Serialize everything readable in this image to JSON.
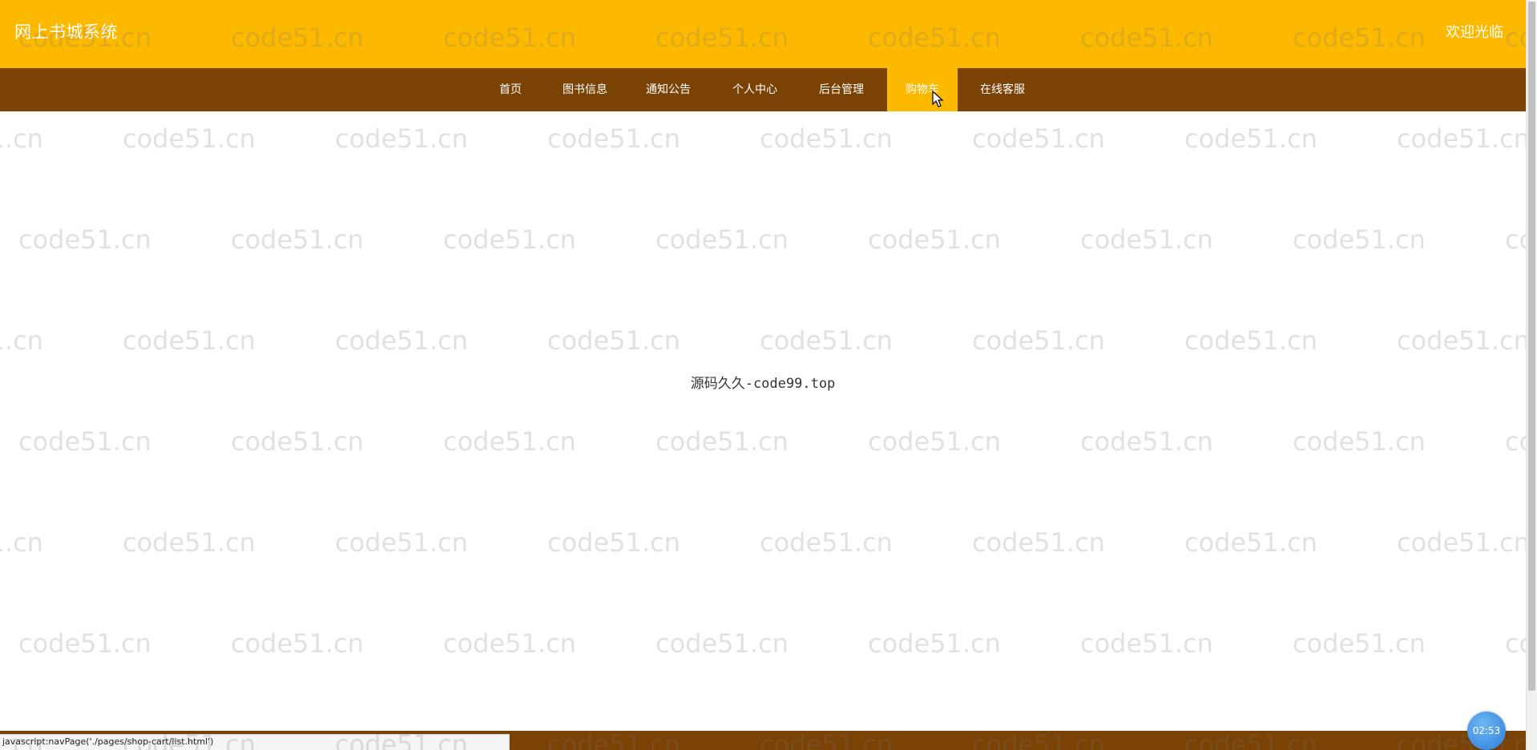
{
  "header": {
    "site_title": "网上书城系统",
    "welcome_text": "欢迎光临"
  },
  "nav": {
    "items": [
      {
        "label": "首页",
        "active": false
      },
      {
        "label": "图书信息",
        "active": false
      },
      {
        "label": "通知公告",
        "active": false
      },
      {
        "label": "个人中心",
        "active": false
      },
      {
        "label": "后台管理",
        "active": false
      },
      {
        "label": "购物车",
        "active": true
      },
      {
        "label": "在线客服",
        "active": false
      }
    ]
  },
  "main": {
    "center_text": "源码久久-code99.top"
  },
  "status_bar": {
    "url": "javascript:navPage('./pages/shop-cart/list.html')"
  },
  "timer": {
    "label": "02:53"
  },
  "watermark": {
    "text": "code51.cn"
  },
  "colors": {
    "header_bg": "#fdb900",
    "nav_bg": "#7a4205",
    "active_bg": "#fdb900"
  }
}
